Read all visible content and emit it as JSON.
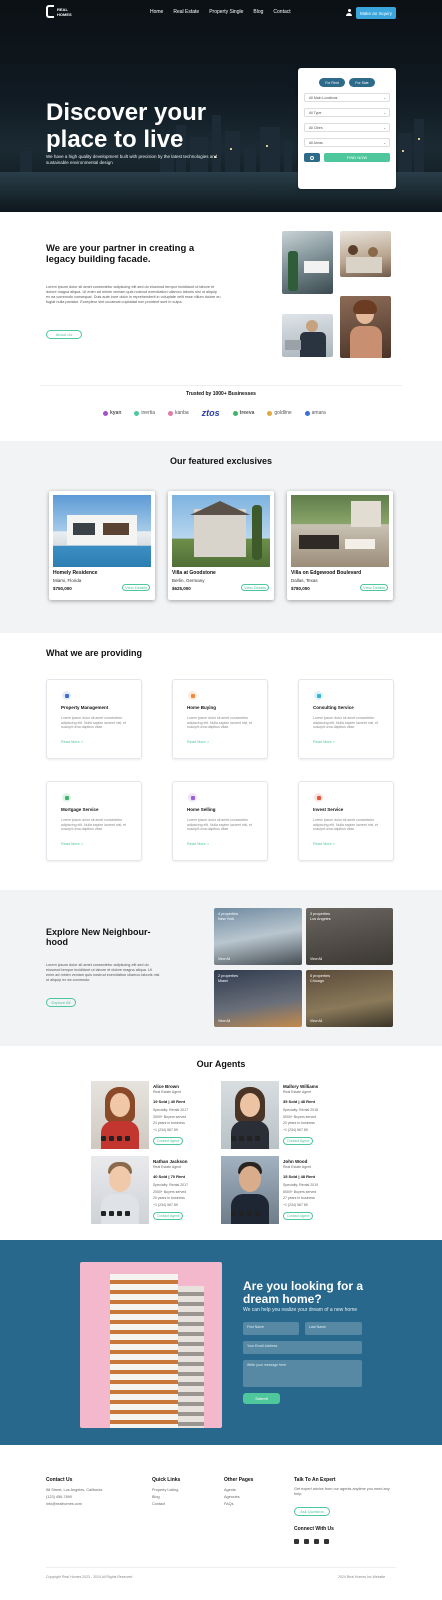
{
  "nav": {
    "logo_line1": "REAL",
    "logo_line2": "HOMES",
    "links": [
      "Home",
      "Real Estate",
      "Property Single",
      "Blog",
      "Contact"
    ],
    "cta": "Make an Inquiry"
  },
  "hero": {
    "title": "Discover your place to live",
    "subtitle": "We have a high quality development built with precision by the latest technologies and sustainable environmental design"
  },
  "search": {
    "tabs": [
      "For Rent",
      "For Sale"
    ],
    "selects": [
      "All Main Locations",
      "All Type",
      "All Cities",
      "All Areas"
    ],
    "find": "FIND NOW"
  },
  "partner": {
    "title": "We are your partner in creating a legacy building facade.",
    "body": "Lorem ipsum dolor sit amet consectetur adipiscing elit sed do eiusmod tempor incididunt ut labore et dolore magna aliqua. Ut enim ad minim veniam quis nostrud exercitation ullamco laboris nisi ut aliquip ex ea commodo consequat. Duis aute irure dolor in reprehenderit in voluptate velit esse cillum dolore eu fugiat nulla pariatur. Excepteur sint occaecat cupidatat non proident sunt in culpa.",
    "button": "About Us"
  },
  "trusted": {
    "title": "Trusted by 1000+ Businesses",
    "logos": [
      "kyan",
      "inertia",
      "kanba",
      "ztos",
      "treeva",
      "goldline",
      "amara"
    ]
  },
  "featured": {
    "title": "Our featured exclusives",
    "cards": [
      {
        "name": "Homely Residence",
        "location": "Miami, Florida",
        "price": "$750,000",
        "button": "View Details"
      },
      {
        "name": "Villa at Goodstone",
        "location": "Berlin, Germany",
        "price": "$625,000",
        "button": "View Details"
      },
      {
        "name": "Villa on Edgewood Boulevard",
        "location": "Dallas, Texas",
        "price": "$780,000",
        "button": "View Details"
      }
    ]
  },
  "providing": {
    "title": "What we are providing",
    "services": [
      {
        "name": "Property Management",
        "desc": "Lorem ipsum dolor sit amet consectetur adipiscing elit. Nulla sapien laoreet nisl, et suscipit urna dapibus vitae.",
        "link": "Read More >",
        "color": "#3b6fd6"
      },
      {
        "name": "Home Buying",
        "desc": "Lorem ipsum dolor sit amet consectetur adipiscing elit. Nulla sapien laoreet nisl, et suscipit urna dapibus vitae.",
        "link": "Read More >",
        "color": "#f08a3a"
      },
      {
        "name": "Consulting Service",
        "desc": "Lorem ipsum dolor sit amet consectetur adipiscing elit. Nulla sapien laoreet nisl, et suscipit urna dapibus vitae.",
        "link": "Read More >",
        "color": "#33b5d6"
      },
      {
        "name": "Mortgage Service",
        "desc": "Lorem ipsum dolor sit amet consectetur adipiscing elit. Nulla sapien laoreet nisl, et suscipit urna dapibus vitae.",
        "link": "Read More >",
        "color": "#3fb36b"
      },
      {
        "name": "Home Selling",
        "desc": "Lorem ipsum dolor sit amet consectetur adipiscing elit. Nulla sapien laoreet nisl, et suscipit urna dapibus vitae.",
        "link": "Read More >",
        "color": "#9b5fd6"
      },
      {
        "name": "Invest Service",
        "desc": "Lorem ipsum dolor sit amet consectetur adipiscing elit. Nulla sapien laoreet nisl, et suscipit urna dapibus vitae.",
        "link": "Read More >",
        "color": "#e5533b"
      }
    ]
  },
  "neighbourhood": {
    "title": "Explore New Neighbour-hood",
    "body": "Lorem ipsum dolor sit amet consectetur adipiscing elit sed do eiusmod tempor incididunt ut labore et dolore magna aliqua. Ut enim ad minim veniam quis nostrud exercitation ullamco laboris nisi ut aliquip ex ea commodo.",
    "button": "Explore All",
    "tiles": [
      {
        "count": "4 properties",
        "city": "New York",
        "link": "View All"
      },
      {
        "count": "3 properties",
        "city": "Los Angeles",
        "link": "View All"
      },
      {
        "count": "2 properties",
        "city": "Miami",
        "link": "View All"
      },
      {
        "count": "5 properties",
        "city": "Chicago",
        "link": "View All"
      }
    ]
  },
  "agents": {
    "title": "Our Agents",
    "list": [
      {
        "name": "Alice Brown",
        "role": "Real Estate Agent",
        "listings": "19 Sold | 40 Rent",
        "info": [
          "Specialty: Rental 2017",
          "3000+ Buyers served",
          "24 years in business",
          "+1 (234) 567 89"
        ],
        "contact": "Contact Agent"
      },
      {
        "name": "Mallory Williams",
        "role": "Real Estate Agent",
        "listings": "35 Sold | 48 Rent",
        "info": [
          "Specialty: Rental 2018",
          "5000+ Buyers served",
          "20 years in business",
          "+1 (234) 567 89"
        ],
        "contact": "Contact Agent"
      },
      {
        "name": "Nathan Jackson",
        "role": "Real Estate Agent",
        "listings": "40 Sold | 70 Rent",
        "info": [
          "Specialty: Rental 2017",
          "2000+ Buyers served",
          "20 years in business",
          "+1 (234) 567 89"
        ],
        "contact": "Contact Agent"
      },
      {
        "name": "John Wood",
        "role": "Real Estate Agent",
        "listings": "15 Sold | 48 Rent",
        "info": [
          "Specialty: Rental 2019",
          "5000+ Buyers served",
          "27 years in business",
          "+1 (234) 567 89"
        ],
        "contact": "Contact Agent"
      }
    ]
  },
  "cta": {
    "title": "Are you looking for a dream home?",
    "subtitle": "We can help you realize your dream of a new home",
    "fields": [
      "First Name",
      "Last Name",
      "Your Email Address",
      "Write your message here"
    ],
    "submit": "Submit"
  },
  "footer": {
    "cols": [
      {
        "title": "Contact Us",
        "lines": [
          "58 Street, Los Angeles, California",
          "(123) 456-7890",
          "info@realhomes.com"
        ]
      },
      {
        "title": "Quick Links",
        "lines": [
          "Property Listing",
          "Blog",
          "Contact"
        ]
      },
      {
        "title": "Other Pages",
        "lines": [
          "Agents",
          "Agencies",
          "FAQs"
        ]
      }
    ],
    "expert": {
      "title": "Talk To An Expert",
      "text": "Get expert advice from our agents anytime you need any help.",
      "button": "Ask Question"
    },
    "connect": "Connect With Us",
    "copyright": "Copyright Real Homes 2023 - 2024 All Rights Reserved",
    "right": "2024 Real Homes Inc Website"
  }
}
